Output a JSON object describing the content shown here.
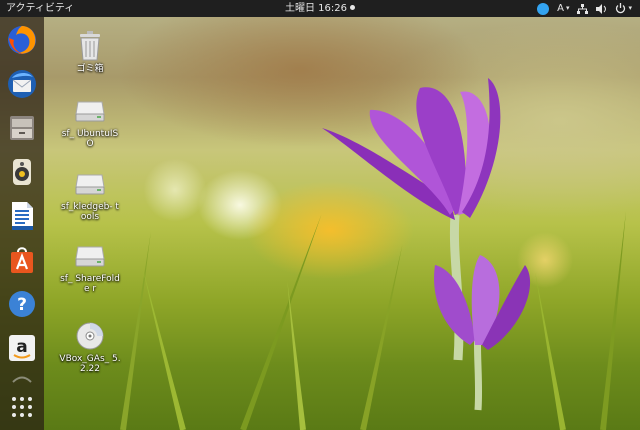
{
  "topbar": {
    "activities_label": "アクティビティ",
    "clock_text": "土曜日 16:26",
    "input_method_label": "A",
    "icons": [
      "skype-icon",
      "network-icon",
      "volume-icon",
      "power-icon"
    ]
  },
  "dock": {
    "items": [
      {
        "name": "firefox",
        "icon": "firefox-icon"
      },
      {
        "name": "thunderbird",
        "icon": "thunderbird-icon"
      },
      {
        "name": "files",
        "icon": "files-icon"
      },
      {
        "name": "rhythmbox",
        "icon": "rhythmbox-icon"
      },
      {
        "name": "libreoffice-writer",
        "icon": "writer-icon"
      },
      {
        "name": "ubuntu-software",
        "icon": "software-center-icon"
      },
      {
        "name": "help",
        "icon": "help-icon"
      },
      {
        "name": "amazon",
        "icon": "amazon-icon"
      },
      {
        "name": "show-applications",
        "icon": "app-grid-icon"
      }
    ],
    "amazon_glyph": "a",
    "help_glyph": "?"
  },
  "desktop": {
    "icons": [
      {
        "label": "ゴミ箱",
        "icon": "trash-icon"
      },
      {
        "label": "sf_ UbuntuISO",
        "icon": "drive-icon"
      },
      {
        "label": "sf_kledgeb- tools",
        "icon": "drive-icon"
      },
      {
        "label": "sf_ ShareFolde r",
        "icon": "drive-icon"
      },
      {
        "label": "VBox_GAs_ 5.2.22",
        "icon": "disc-icon"
      }
    ]
  },
  "colors": {
    "topbar_bg": "#1f1f1f",
    "dock_bg": "rgba(40,30,20,0.72)",
    "flower_purple": "#9b3fc8",
    "grass_green": "#7a9a22"
  }
}
